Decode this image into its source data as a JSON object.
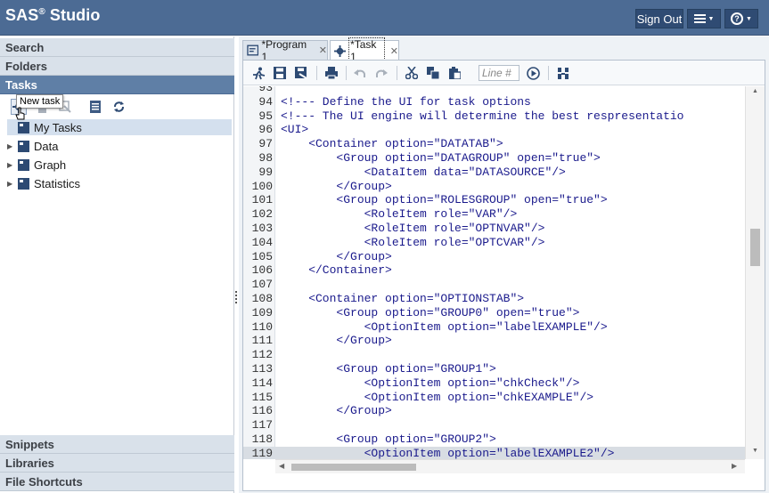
{
  "header": {
    "brand": "SAS",
    "brand_mark": "®",
    "brand_suffix": " Studio",
    "sign_out_label": "Sign Out"
  },
  "left_panel": {
    "sections": {
      "search": "Search",
      "folders": "Folders",
      "tasks": "Tasks",
      "snippets": "Snippets",
      "libraries": "Libraries",
      "file_shortcuts": "File Shortcuts"
    },
    "tooltip": "New task",
    "tree": [
      {
        "label": "My Tasks"
      },
      {
        "label": "Data"
      },
      {
        "label": "Graph"
      },
      {
        "label": "Statistics"
      }
    ]
  },
  "tabs": [
    {
      "label": "*Program 1",
      "active": false
    },
    {
      "label": "*Task 1",
      "active": true
    }
  ],
  "editor": {
    "line_input_placeholder": "Line #",
    "lines": [
      {
        "n": "93",
        "text": ""
      },
      {
        "n": "94",
        "text": "<!--- Define the UI for task options"
      },
      {
        "n": "95",
        "text": "<!--- The UI engine will determine the best respresentatio"
      },
      {
        "n": "96",
        "text": "<UI>"
      },
      {
        "n": "97",
        "text": "    <Container option=\"DATATAB\">"
      },
      {
        "n": "98",
        "text": "        <Group option=\"DATAGROUP\" open=\"true\">"
      },
      {
        "n": "99",
        "text": "            <DataItem data=\"DATASOURCE\"/>"
      },
      {
        "n": "100",
        "text": "        </Group>"
      },
      {
        "n": "101",
        "text": "        <Group option=\"ROLESGROUP\" open=\"true\">"
      },
      {
        "n": "102",
        "text": "            <RoleItem role=\"VAR\"/>"
      },
      {
        "n": "103",
        "text": "            <RoleItem role=\"OPTNVAR\"/>"
      },
      {
        "n": "104",
        "text": "            <RoleItem role=\"OPTCVAR\"/>"
      },
      {
        "n": "105",
        "text": "        </Group>"
      },
      {
        "n": "106",
        "text": "    </Container>"
      },
      {
        "n": "107",
        "text": ""
      },
      {
        "n": "108",
        "text": "    <Container option=\"OPTIONSTAB\">"
      },
      {
        "n": "109",
        "text": "        <Group option=\"GROUP0\" open=\"true\">"
      },
      {
        "n": "110",
        "text": "            <OptionItem option=\"labelEXAMPLE\"/>"
      },
      {
        "n": "111",
        "text": "        </Group>"
      },
      {
        "n": "112",
        "text": ""
      },
      {
        "n": "113",
        "text": "        <Group option=\"GROUP1\">"
      },
      {
        "n": "114",
        "text": "            <OptionItem option=\"chkCheck\"/>"
      },
      {
        "n": "115",
        "text": "            <OptionItem option=\"chkEXAMPLE\"/>"
      },
      {
        "n": "116",
        "text": "        </Group>"
      },
      {
        "n": "117",
        "text": ""
      },
      {
        "n": "118",
        "text": "        <Group option=\"GROUP2\">"
      },
      {
        "n": "119",
        "text": "            <OptionItem option=\"labelEXAMPLE2\"/>"
      }
    ],
    "current_line": "119"
  },
  "colors": {
    "header_bg": "#4c6b94",
    "active_section_bg": "#5f7fa6",
    "code_text": "#1a1a8c"
  }
}
